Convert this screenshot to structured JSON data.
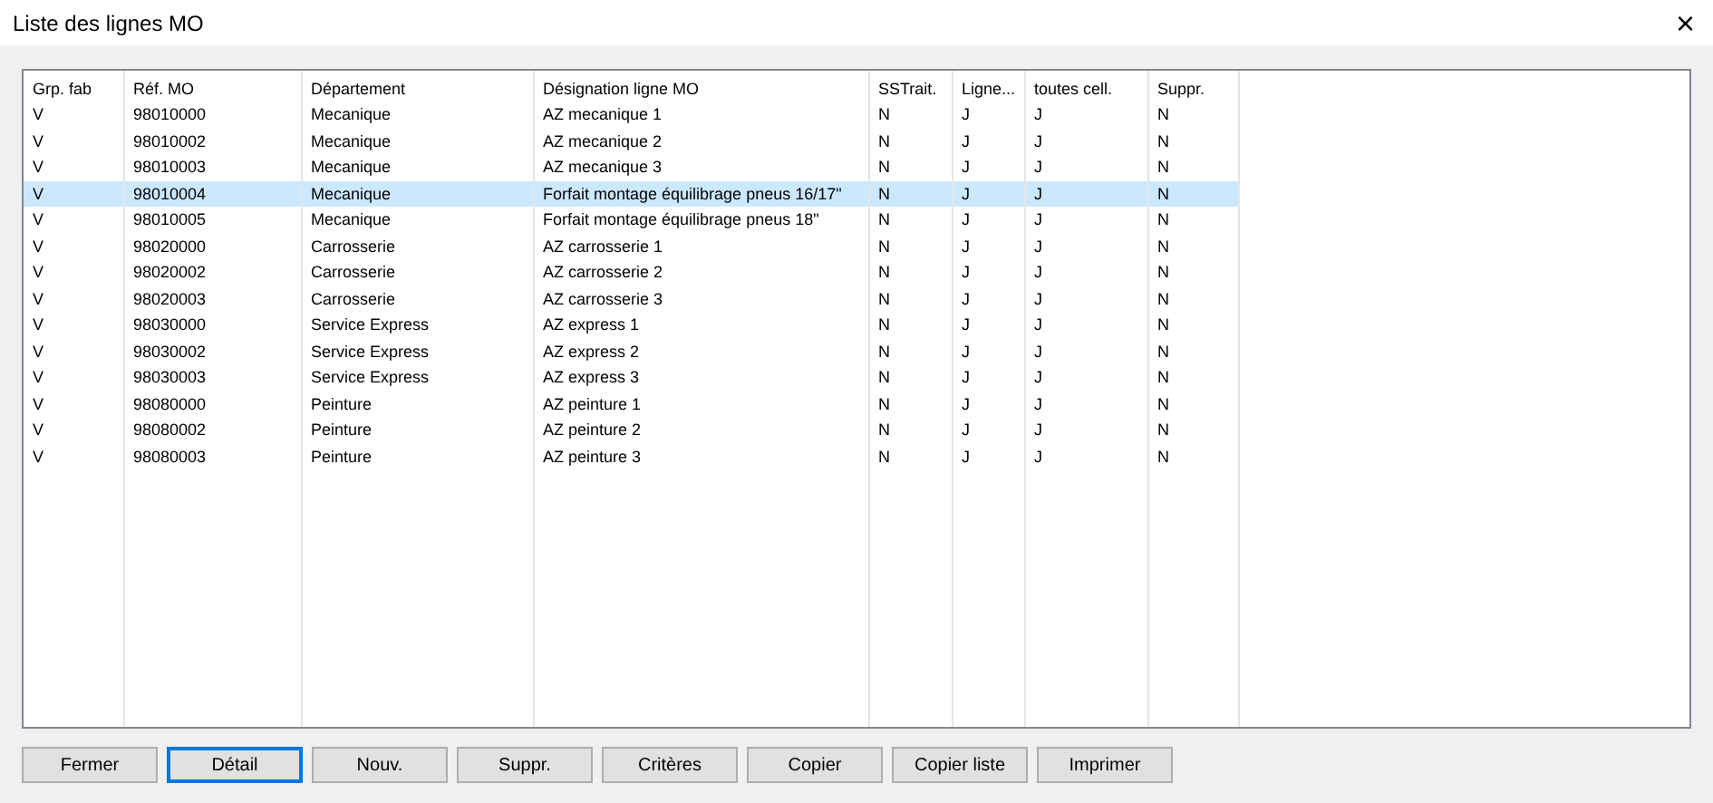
{
  "window": {
    "title": "Liste des lignes MO",
    "close": "×"
  },
  "table": {
    "columns": [
      "Grp. fab",
      "Réf. MO",
      "Département",
      "Désignation ligne MO",
      "SSTrait.",
      "Ligne...",
      "toutes cell.",
      "Suppr."
    ],
    "rows": [
      {
        "cells": [
          "V",
          "98010000",
          "Mecanique",
          "AZ mecanique 1",
          "N",
          "J",
          "J",
          "N"
        ],
        "selected": false
      },
      {
        "cells": [
          "V",
          "98010002",
          "Mecanique",
          "AZ mecanique 2",
          "N",
          "J",
          "J",
          "N"
        ],
        "selected": false
      },
      {
        "cells": [
          "V",
          "98010003",
          "Mecanique",
          "AZ mecanique 3",
          "N",
          "J",
          "J",
          "N"
        ],
        "selected": false
      },
      {
        "cells": [
          "V",
          "98010004",
          "Mecanique",
          "Forfait montage équilibrage pneus 16/17\"",
          "N",
          "J",
          "J",
          "N"
        ],
        "selected": true
      },
      {
        "cells": [
          "V",
          "98010005",
          "Mecanique",
          "Forfait montage équilibrage pneus 18\"",
          "N",
          "J",
          "J",
          "N"
        ],
        "selected": false
      },
      {
        "cells": [
          "V",
          "98020000",
          "Carrosserie",
          "AZ carrosserie 1",
          "N",
          "J",
          "J",
          "N"
        ],
        "selected": false
      },
      {
        "cells": [
          "V",
          "98020002",
          "Carrosserie",
          "AZ carrosserie 2",
          "N",
          "J",
          "J",
          "N"
        ],
        "selected": false
      },
      {
        "cells": [
          "V",
          "98020003",
          "Carrosserie",
          "AZ carrosserie 3",
          "N",
          "J",
          "J",
          "N"
        ],
        "selected": false
      },
      {
        "cells": [
          "V",
          "98030000",
          "Service Express",
          "AZ express 1",
          "N",
          "J",
          "J",
          "N"
        ],
        "selected": false
      },
      {
        "cells": [
          "V",
          "98030002",
          "Service Express",
          "AZ express 2",
          "N",
          "J",
          "J",
          "N"
        ],
        "selected": false
      },
      {
        "cells": [
          "V",
          "98030003",
          "Service Express",
          "AZ express 3",
          "N",
          "J",
          "J",
          "N"
        ],
        "selected": false
      },
      {
        "cells": [
          "V",
          "98080000",
          "Peinture",
          "AZ peinture 1",
          "N",
          "J",
          "J",
          "N"
        ],
        "selected": false
      },
      {
        "cells": [
          "V",
          "98080002",
          "Peinture",
          "AZ peinture 2",
          "N",
          "J",
          "J",
          "N"
        ],
        "selected": false
      },
      {
        "cells": [
          "V",
          "98080003",
          "Peinture",
          "AZ peinture 3",
          "N",
          "J",
          "J",
          "N"
        ],
        "selected": false
      }
    ]
  },
  "buttons": [
    {
      "label": "Fermer",
      "focused": false
    },
    {
      "label": "Détail",
      "focused": true
    },
    {
      "label": "Nouv.",
      "focused": false
    },
    {
      "label": "Suppr.",
      "focused": false
    },
    {
      "label": "Critères",
      "focused": false
    },
    {
      "label": "Copier",
      "focused": false
    },
    {
      "label": "Copier liste",
      "focused": false
    },
    {
      "label": "Imprimer",
      "focused": false
    }
  ]
}
